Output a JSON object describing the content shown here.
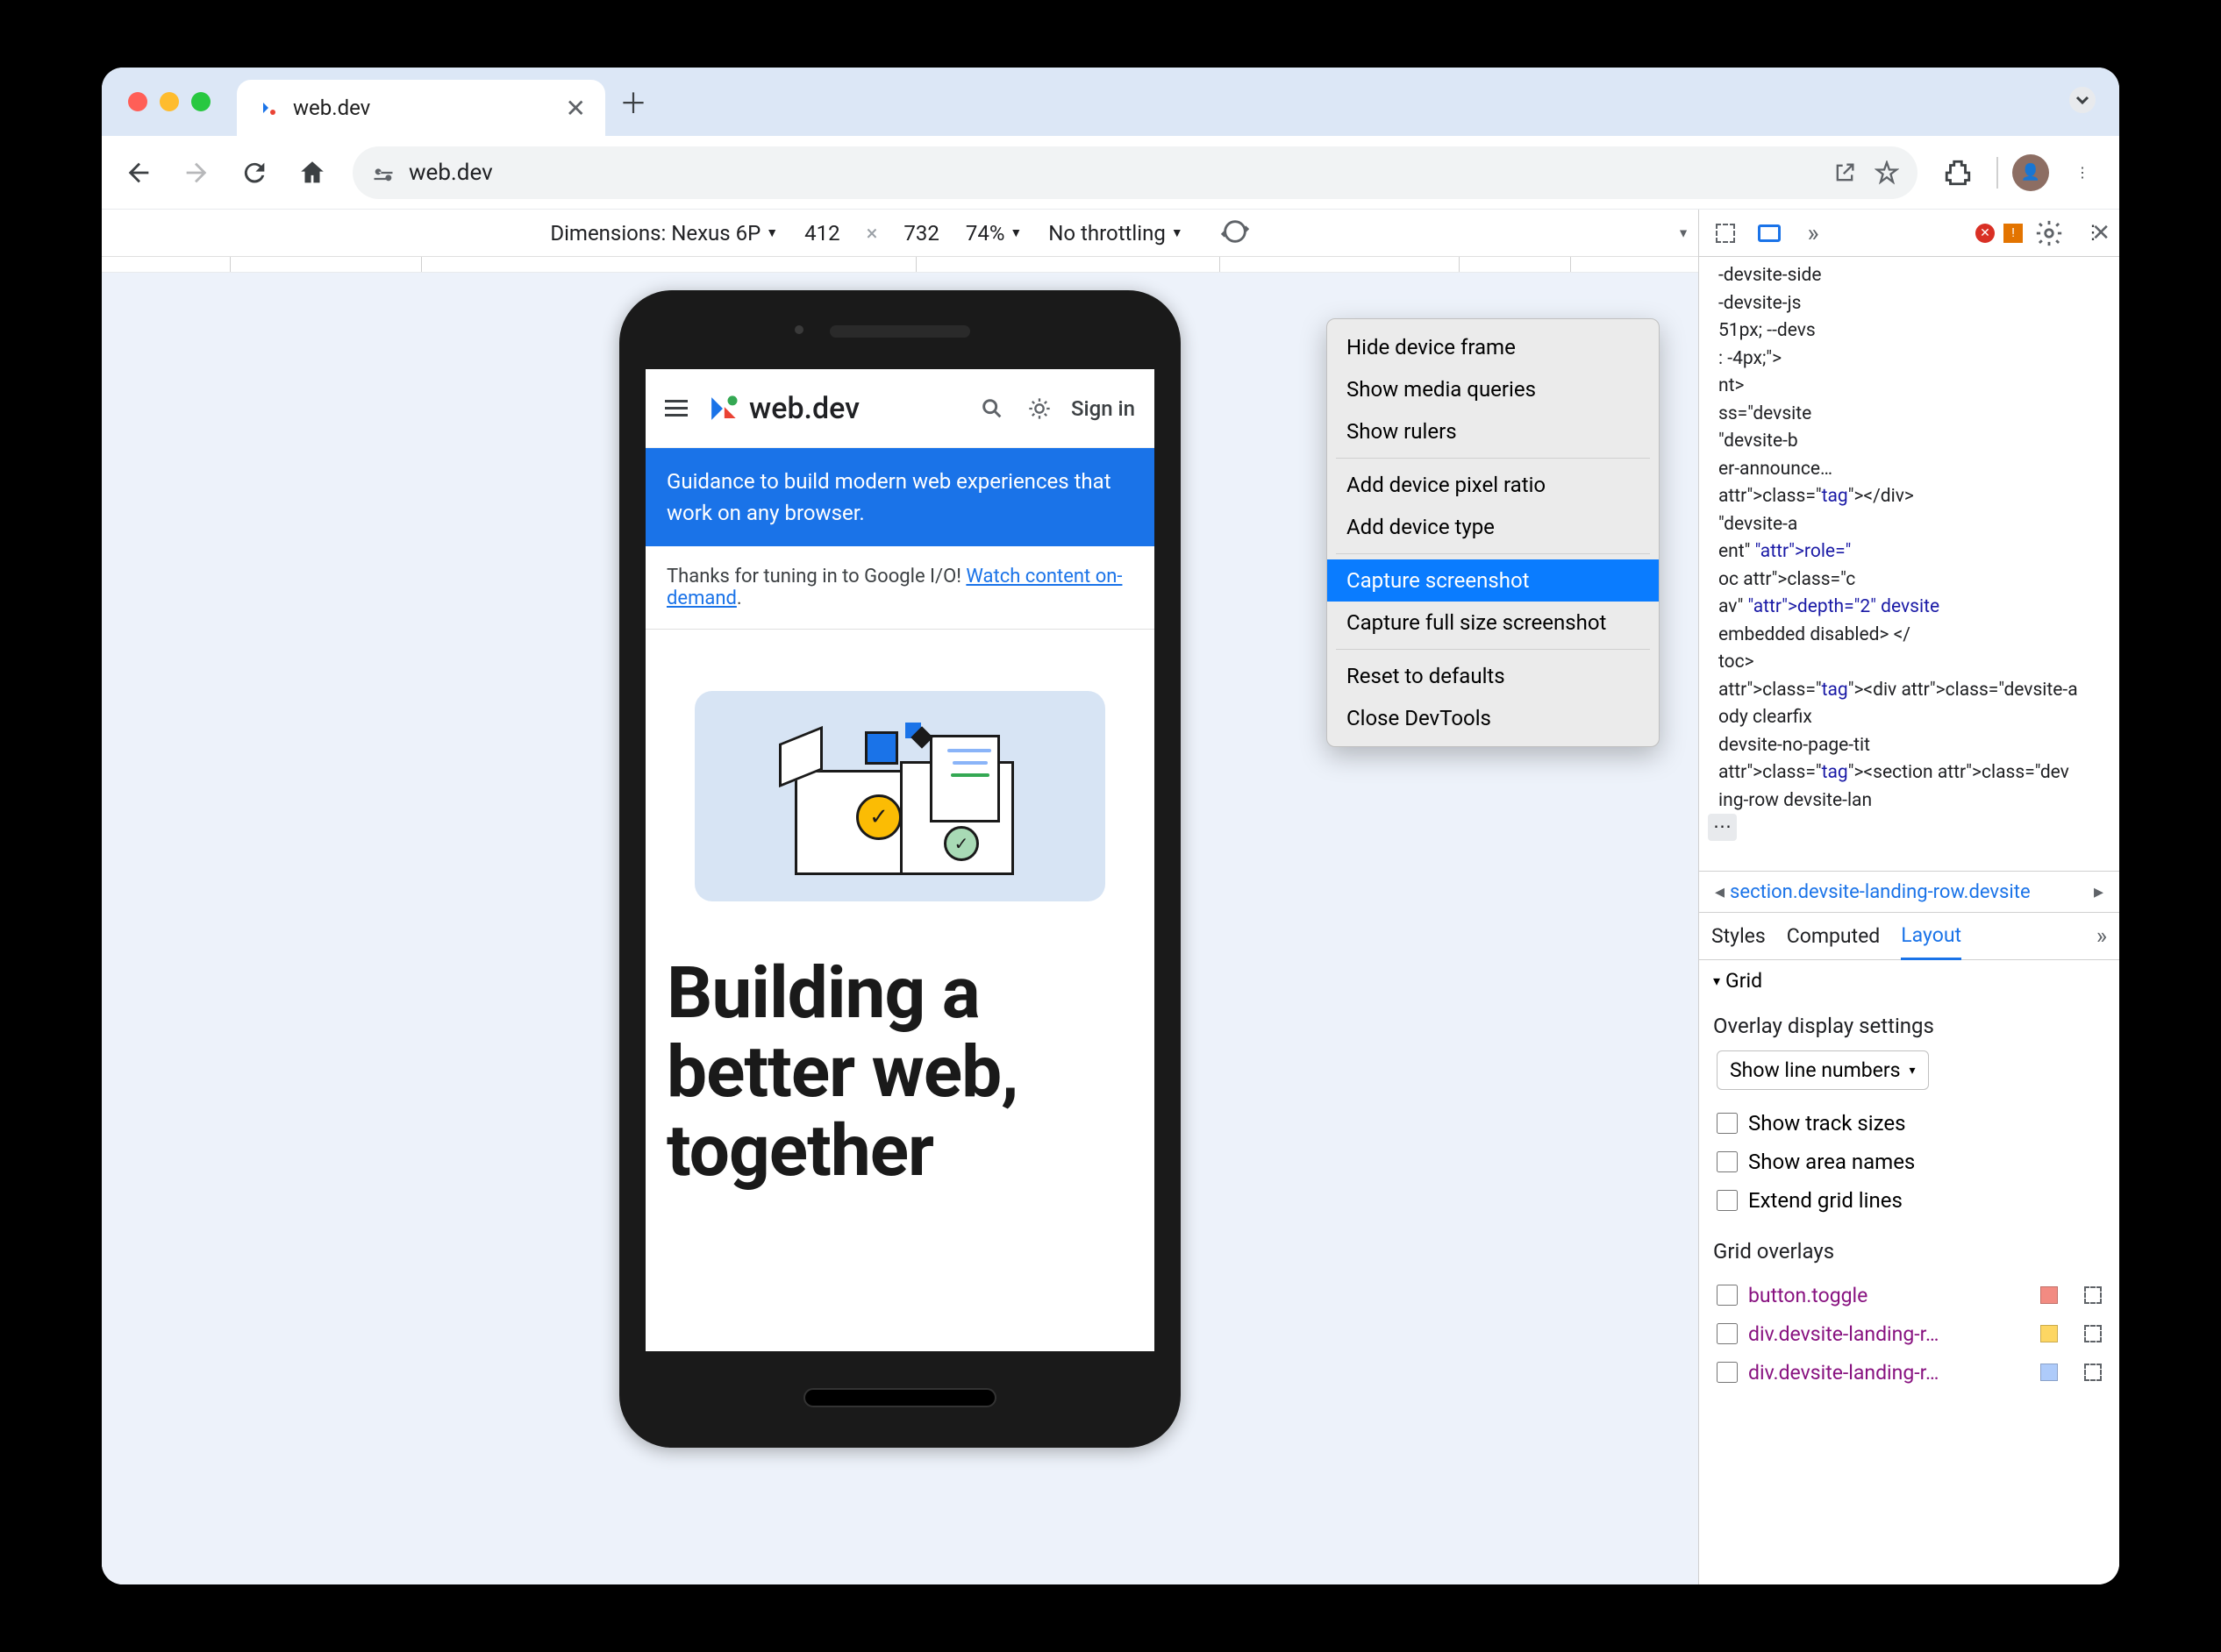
{
  "tab": {
    "title": "web.dev",
    "favicon": "webdev"
  },
  "toolbar": {
    "url": "web.dev"
  },
  "device_toolbar": {
    "dimensions_label": "Dimensions:",
    "device": "Nexus 6P",
    "width": "412",
    "height": "732",
    "zoom": "74%",
    "throttling": "No throttling"
  },
  "page": {
    "logo": "web.dev",
    "signin": "Sign in",
    "blue_banner": "Guidance to build modern web experiences that work on any browser.",
    "notice_prefix": "Thanks for tuning in to Google I/O! ",
    "notice_link": "Watch content on-demand",
    "notice_suffix": ".",
    "headline": "Building a better web, together"
  },
  "context_menu": {
    "items_group1": [
      "Hide device frame",
      "Show media queries",
      "Show rulers"
    ],
    "items_group2": [
      "Add device pixel ratio",
      "Add device type"
    ],
    "items_group3": [
      "Capture screenshot",
      "Capture full size screenshot"
    ],
    "items_group4": [
      "Reset to defaults",
      "Close DevTools"
    ],
    "highlighted": "Capture screenshot"
  },
  "devtools": {
    "elements_snippets": [
      "-devsite-side",
      "-devsite-js",
      "51px; --devs",
      ": -4px;\">",
      "nt>",
      "ss=\"devsite",
      "\"devsite-b",
      "er-announce…",
      "</div>",
      "\"devsite-a",
      "ent\" role=\"",
      "oc class=\"c",
      "av\" depth=\"2\" devsite",
      "embedded disabled> </",
      "toc>",
      "<div class=\"devsite-a",
      "ody clearfix",
      " devsite-no-page-tit",
      "<section class=\"dev",
      "ing-row devsite-lan"
    ],
    "breadcrumb": "section.devsite-landing-row.devsite",
    "tabs": [
      "Styles",
      "Computed",
      "Layout"
    ],
    "active_tab": "Layout",
    "grid_section": "Grid",
    "overlay_title": "Overlay display settings",
    "line_numbers": "Show line numbers",
    "checks": [
      "Show track sizes",
      "Show area names",
      "Extend grid lines"
    ],
    "grid_overlays_title": "Grid overlays",
    "overlays": [
      {
        "label": "button.toggle",
        "color": "#f28b82"
      },
      {
        "label": "div.devsite-landing-r…",
        "color": "#fdd663"
      },
      {
        "label": "div.devsite-landing-r…",
        "color": "#aecbfa"
      }
    ]
  }
}
